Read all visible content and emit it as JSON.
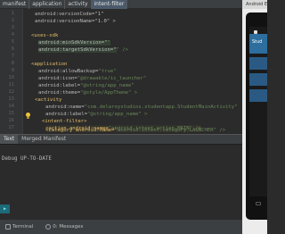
{
  "breadcrumbs": [
    "manifest",
    "application",
    "activity",
    "intent-filter"
  ],
  "gutter": {
    "line_numbers": [
      "1",
      "2",
      "3",
      "4",
      "5",
      "6",
      "7",
      "8",
      "9",
      "10",
      "11",
      "12",
      "13",
      "14",
      "15",
      "16",
      "17"
    ]
  },
  "code": {
    "line1": "android:versionCode=\"1\"",
    "line2": "android:versionName=\"1.0\" >",
    "line4a": "<uses-sdk",
    "line5a": "android:minSdkVersion=\"",
    "line5b": "\"",
    "line6a": "android:targetSdkVersion=\"",
    "line6b": "\" />",
    "line8": "<application",
    "line9a": "android:allowBackup=",
    "line9b": "\"true\"",
    "line10a": "android:icon=",
    "line10b": "\"@drawable/ic_launcher\"",
    "line11a": "android:label=",
    "line11b": "\"@string/app_name\"",
    "line12a": "android:theme=",
    "line12b": "\"@style/AppTheme\" >",
    "line13": "<activity",
    "line14a": "android:name=",
    "line14b": "\"com.delaroystudios.studentapp.StudentMainActivity\"",
    "line15a": "android:label=",
    "line15b": "\"@string/app_name\" >",
    "line16": "<intent-filter>",
    "line17a": "<action android:name=",
    "line17b": "\"android.intent.action.MAIN\" />",
    "line19a": "<category android:name=",
    "line19b": "\"android.intent.category.LAUNCHER\" />"
  },
  "tabs": {
    "text": "Text",
    "merged": "Merged Manifest"
  },
  "console": {
    "line": "Debug UP-TO-DATE"
  },
  "bottombar": {
    "terminal": "Terminal",
    "messages": "0: Messages"
  },
  "emulator": {
    "title": "Android E",
    "app_title": "Stud"
  }
}
